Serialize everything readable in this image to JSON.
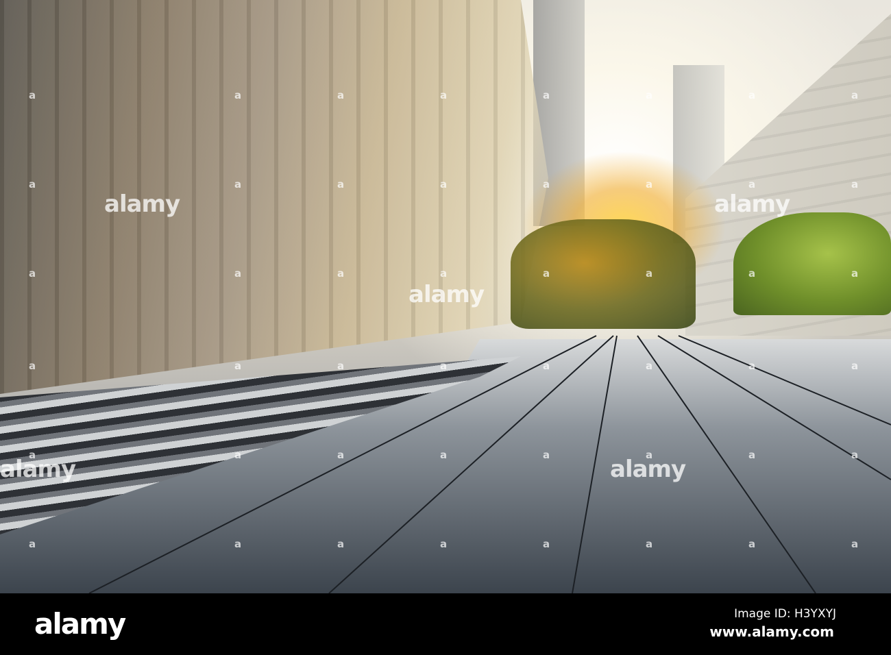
{
  "watermark": {
    "text": "alamy",
    "small": "a"
  },
  "footer": {
    "logo": "alamy",
    "image_id": "Image ID: H3YXYJ",
    "url": "www.alamy.com"
  }
}
